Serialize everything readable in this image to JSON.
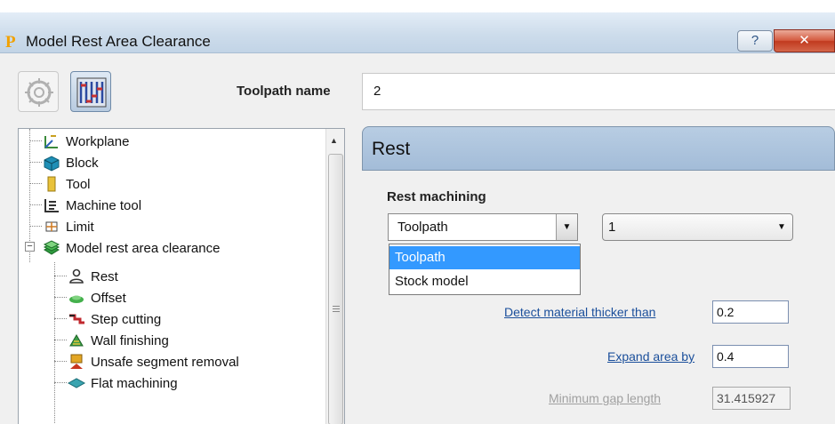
{
  "window": {
    "title": "Model Rest Area Clearance",
    "app_icon": "P",
    "help_label": "?",
    "close_label": "✕"
  },
  "toolbar": {
    "buttons": [
      "strategy-wheel-icon",
      "toolpath-strategy-icon"
    ]
  },
  "toolpath_name": {
    "label": "Toolpath name",
    "value": "2"
  },
  "tree": {
    "items": [
      {
        "label": "Workplane",
        "icon": "workplane-icon"
      },
      {
        "label": "Block",
        "icon": "block-icon"
      },
      {
        "label": "Tool",
        "icon": "tool-icon"
      },
      {
        "label": "Machine tool",
        "icon": "machine-tool-icon"
      },
      {
        "label": "Limit",
        "icon": "limit-icon"
      },
      {
        "label": "Model rest area clearance",
        "icon": "model-rest-area-clearance-icon",
        "expander": "−"
      },
      {
        "label": "Rest",
        "icon": "rest-icon"
      },
      {
        "label": "Offset",
        "icon": "offset-icon"
      },
      {
        "label": "Step cutting",
        "icon": "step-cutting-icon"
      },
      {
        "label": "Wall finishing",
        "icon": "wall-finishing-icon"
      },
      {
        "label": "Unsafe segment removal",
        "icon": "unsafe-segment-removal-icon"
      },
      {
        "label": "Flat machining",
        "icon": "flat-machining-icon"
      }
    ]
  },
  "panel": {
    "title": "Rest",
    "rest_machining_label": "Rest machining",
    "rest_type": {
      "selected": "Toolpath",
      "options": [
        "Toolpath",
        "Stock model"
      ],
      "highlighted": "Toolpath"
    },
    "reference_toolpath": "1",
    "detect_material": {
      "label": "Detect material thicker than",
      "value": "0.2"
    },
    "expand_area": {
      "label": "Expand area by",
      "value": "0.4"
    },
    "minimum_gap": {
      "label": "Minimum gap length",
      "value": "31.415927"
    }
  },
  "colors": {
    "panel_header": "#a9c0da",
    "selection": "#3399ff",
    "link": "#1b4f9b",
    "close_button": "#c94a30"
  }
}
